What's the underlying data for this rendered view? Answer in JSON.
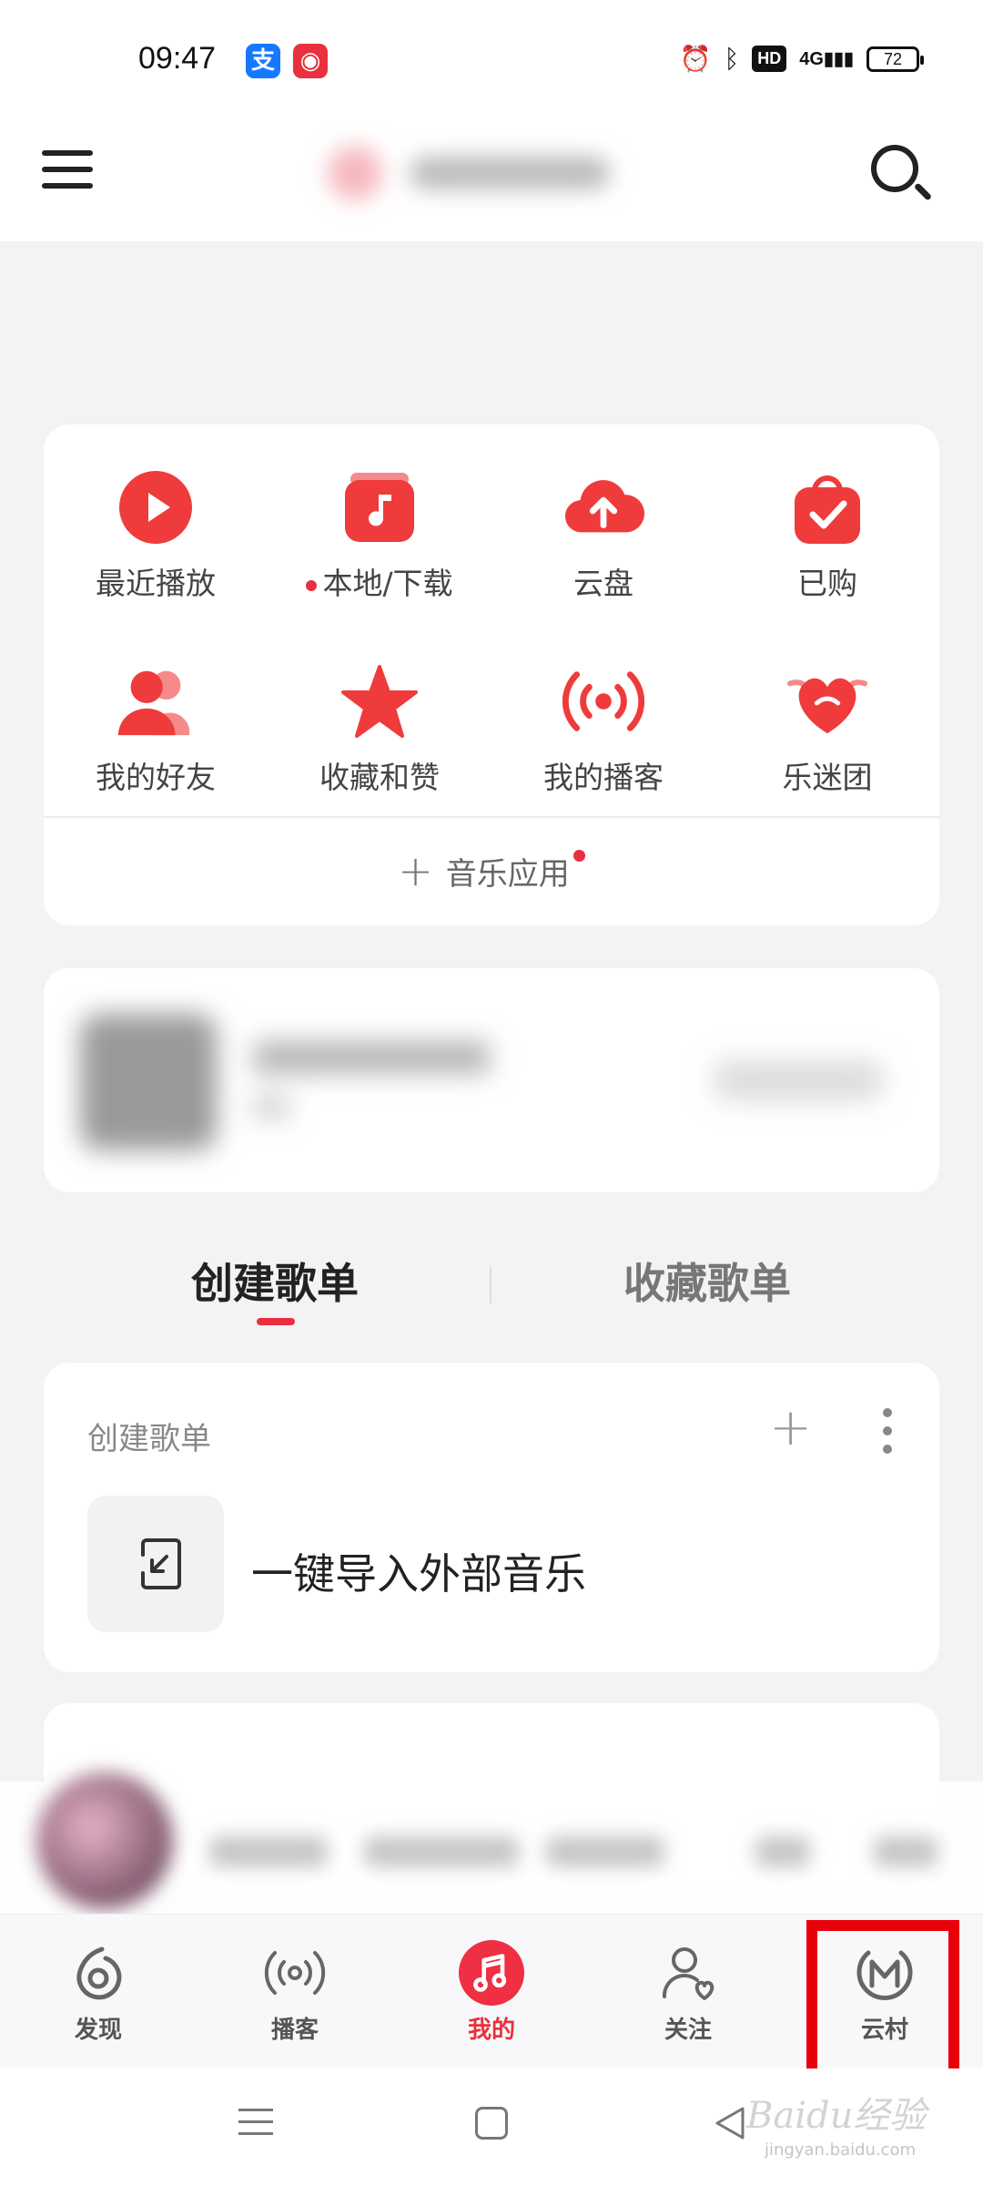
{
  "status_bar": {
    "time": "09:47",
    "battery": "72",
    "network": "4G",
    "hd_label": "HD",
    "app_icons": [
      "alipay-icon",
      "netease-music-icon"
    ]
  },
  "header": {
    "menu_icon": "hamburger-menu-icon",
    "search_icon": "search-icon"
  },
  "quick_access": {
    "items": [
      {
        "label": "最近播放",
        "icon": "recent-play-icon"
      },
      {
        "label": "本地/下载",
        "icon": "local-download-icon",
        "dot": true
      },
      {
        "label": "云盘",
        "icon": "cloud-upload-icon"
      },
      {
        "label": "已购",
        "icon": "purchased-bag-icon"
      },
      {
        "label": "我的好友",
        "icon": "friends-icon"
      },
      {
        "label": "收藏和赞",
        "icon": "star-icon"
      },
      {
        "label": "我的播客",
        "icon": "podcast-icon"
      },
      {
        "label": "乐迷团",
        "icon": "fan-club-heart-icon"
      }
    ],
    "music_app_label": "音乐应用"
  },
  "playlist_tabs": {
    "created": "创建歌单",
    "collected": "收藏歌单",
    "active": "created"
  },
  "playlist_card": {
    "title": "创建歌单",
    "import_label": "一键导入外部音乐"
  },
  "bottom_nav": {
    "items": [
      {
        "label": "发现",
        "icon": "discover-icon"
      },
      {
        "label": "播客",
        "icon": "podcast-icon"
      },
      {
        "label": "我的",
        "icon": "music-note-icon",
        "active": true
      },
      {
        "label": "关注",
        "icon": "follow-user-icon"
      },
      {
        "label": "云村",
        "icon": "yuncun-icon"
      }
    ]
  },
  "watermark": {
    "text": "Baidu经验",
    "sub": "jingyan.baidu.com"
  },
  "colors": {
    "accent": "#e9303e",
    "highlight": "#e8000b",
    "background": "#f3f3f5"
  }
}
